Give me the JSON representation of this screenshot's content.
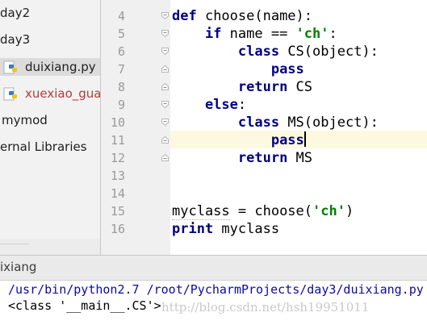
{
  "project_tree": {
    "items": [
      {
        "label": "day2",
        "type": "folder"
      },
      {
        "label": "day3",
        "type": "folder"
      },
      {
        "label": "duixiang.py",
        "type": "python-file",
        "selected": true
      },
      {
        "label": "xuexiao_gua",
        "type": "python-file",
        "error": true
      },
      {
        "label": "mymod",
        "type": "folder"
      },
      {
        "label": "ernal Libraries",
        "type": "libraries"
      }
    ]
  },
  "editor": {
    "line_numbers": [
      "4",
      "5",
      "6",
      "7",
      "8",
      "9",
      "10",
      "11",
      "12",
      "13",
      "14",
      "15",
      "16"
    ],
    "current_line": "11",
    "code": {
      "l4_kw": "def",
      "l4_rest": " choose(name):",
      "l5_kw": "if",
      "l5_mid": " name == ",
      "l5_str": "'ch'",
      "l5_end": ":",
      "l6_kw": "class",
      "l6_rest": " CS(object):",
      "l7_kw": "pass",
      "l8_kw": "return",
      "l8_rest": " CS",
      "l9_kw": "else",
      "l9_rest": ":",
      "l10_kw": "class",
      "l10_rest": " MS(object):",
      "l11_kw": "pass",
      "l12_kw": "return",
      "l12_rest": " MS",
      "l15_var": "myclass",
      "l15_mid": " = choose(",
      "l15_str": "'ch'",
      "l15_end": ")",
      "l16_kw": "print",
      "l16_rest": " myclass"
    }
  },
  "run_panel": {
    "title": "ixiang",
    "command": "/usr/bin/python2.7 /root/PycharmProjects/day3/duixiang.py",
    "output": "<class '__main__.CS'>"
  },
  "watermark": "http://blog.csdn.net/hsh19951011",
  "colors": {
    "keyword": "#000080",
    "string": "#008000",
    "current_line_bg": "#fdf8e0",
    "console_command": "#0a0aa8"
  }
}
